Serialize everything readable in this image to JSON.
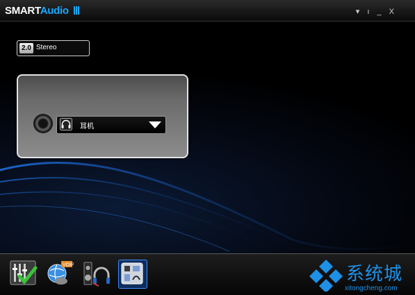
{
  "app": {
    "brand_part1": "SMART",
    "brand_part2": "Audio",
    "window_controls": [
      "▾",
      "ı",
      "_",
      "X"
    ]
  },
  "stereo": {
    "channel": "2.0",
    "label": "Stereo"
  },
  "device": {
    "selected": "耳机"
  },
  "toolbar": [
    {
      "icon": "equalizer-check-icon"
    },
    {
      "icon": "voip-globe-icon"
    },
    {
      "icon": "speaker-headphone-icon"
    },
    {
      "icon": "audio-director-icon",
      "active": true
    }
  ],
  "watermark": {
    "text": "系统城",
    "sub": "xitongcheng.com"
  },
  "colors": {
    "accent": "#19a7ff",
    "watermark": "#1e90e6"
  }
}
